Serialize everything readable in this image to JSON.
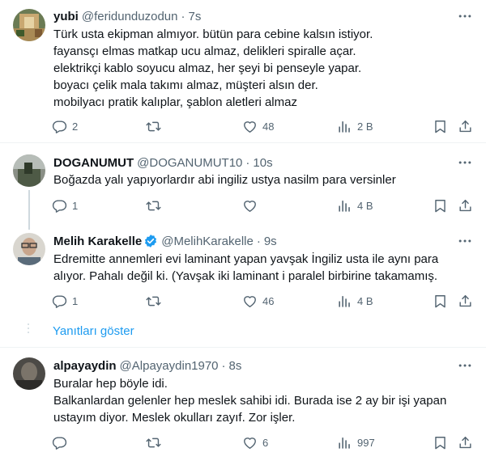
{
  "tweets": [
    {
      "name": "yubi",
      "handle": "@feridunduzodun",
      "time": "7s",
      "lines": [
        "Türk usta ekipman almıyor. bütün para cebine kalsın istiyor.",
        "fayansçı elmas matkap ucu almaz, delikleri spiralle açar.",
        "elektrikçi kablo soyucu almaz, her şeyi bi penseyle yapar.",
        "boyacı çelik mala takımı almaz, müşteri alsın der.",
        "mobilyacı pratik kalıplar, şablon aletleri almaz"
      ],
      "replies": "2",
      "retweets": "",
      "likes": "48",
      "views": "2 B"
    },
    {
      "name": "DOGANUMUT",
      "handle": "@DOGANUMUT10",
      "time": "10s",
      "lines": [
        "Boğazda yalı yapıyorlardır abi ingiliz ustya nasilm para versinler"
      ],
      "replies": "1",
      "retweets": "",
      "likes": "",
      "views": "4 B"
    },
    {
      "name": "Melih Karakelle",
      "handle": "@MelihKarakelle",
      "time": "9s",
      "verified": true,
      "lines": [
        "Edremitte annemleri evi laminant yapan yavşak İngiliz usta ile aynı para",
        "alıyor. Pahalı değil ki. (Yavşak iki laminant i paralel birbirine takamamış."
      ],
      "replies": "1",
      "retweets": "",
      "likes": "46",
      "views": "4 B"
    },
    {
      "name": "alpayaydin",
      "handle": "@Alpayaydin1970",
      "time": "8s",
      "lines": [
        "Buralar hep böyle idi.",
        "Balkanlardan gelenler hep meslek sahibi idi. Burada ise 2 ay bir işi yapan",
        "ustayım diyor. Meslek okulları zayıf. Zor işler."
      ],
      "replies": "",
      "retweets": "",
      "likes": "6",
      "views": "997"
    }
  ],
  "show_replies_label": "Yanıtları göster",
  "colors": {
    "text": "#0f1419",
    "secondary": "#536471",
    "link": "#1d9bf0",
    "verified": "#1d9bf0",
    "border": "#eff3f4"
  },
  "icons": [
    "reply-icon",
    "retweet-icon",
    "like-icon",
    "views-icon",
    "bookmark-icon",
    "share-icon",
    "more-icon",
    "verified-badge-icon"
  ]
}
